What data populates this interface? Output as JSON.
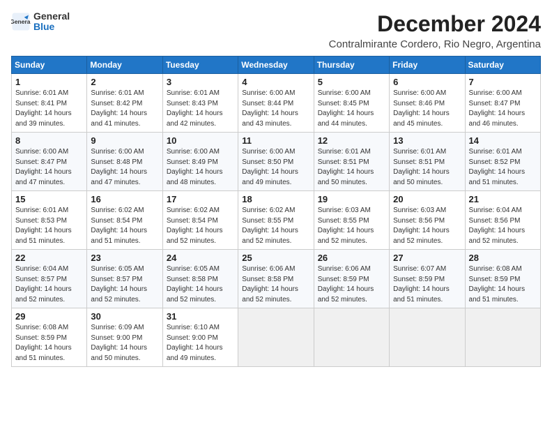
{
  "logo": {
    "general": "General",
    "blue": "Blue"
  },
  "title": "December 2024",
  "subtitle": "Contralmirante Cordero, Rio Negro, Argentina",
  "days_of_week": [
    "Sunday",
    "Monday",
    "Tuesday",
    "Wednesday",
    "Thursday",
    "Friday",
    "Saturday"
  ],
  "weeks": [
    [
      {
        "day": "1",
        "sunrise": "Sunrise: 6:01 AM",
        "sunset": "Sunset: 8:41 PM",
        "daylight": "Daylight: 14 hours and 39 minutes."
      },
      {
        "day": "2",
        "sunrise": "Sunrise: 6:01 AM",
        "sunset": "Sunset: 8:42 PM",
        "daylight": "Daylight: 14 hours and 41 minutes."
      },
      {
        "day": "3",
        "sunrise": "Sunrise: 6:01 AM",
        "sunset": "Sunset: 8:43 PM",
        "daylight": "Daylight: 14 hours and 42 minutes."
      },
      {
        "day": "4",
        "sunrise": "Sunrise: 6:00 AM",
        "sunset": "Sunset: 8:44 PM",
        "daylight": "Daylight: 14 hours and 43 minutes."
      },
      {
        "day": "5",
        "sunrise": "Sunrise: 6:00 AM",
        "sunset": "Sunset: 8:45 PM",
        "daylight": "Daylight: 14 hours and 44 minutes."
      },
      {
        "day": "6",
        "sunrise": "Sunrise: 6:00 AM",
        "sunset": "Sunset: 8:46 PM",
        "daylight": "Daylight: 14 hours and 45 minutes."
      },
      {
        "day": "7",
        "sunrise": "Sunrise: 6:00 AM",
        "sunset": "Sunset: 8:47 PM",
        "daylight": "Daylight: 14 hours and 46 minutes."
      }
    ],
    [
      {
        "day": "8",
        "sunrise": "Sunrise: 6:00 AM",
        "sunset": "Sunset: 8:47 PM",
        "daylight": "Daylight: 14 hours and 47 minutes."
      },
      {
        "day": "9",
        "sunrise": "Sunrise: 6:00 AM",
        "sunset": "Sunset: 8:48 PM",
        "daylight": "Daylight: 14 hours and 47 minutes."
      },
      {
        "day": "10",
        "sunrise": "Sunrise: 6:00 AM",
        "sunset": "Sunset: 8:49 PM",
        "daylight": "Daylight: 14 hours and 48 minutes."
      },
      {
        "day": "11",
        "sunrise": "Sunrise: 6:00 AM",
        "sunset": "Sunset: 8:50 PM",
        "daylight": "Daylight: 14 hours and 49 minutes."
      },
      {
        "day": "12",
        "sunrise": "Sunrise: 6:01 AM",
        "sunset": "Sunset: 8:51 PM",
        "daylight": "Daylight: 14 hours and 50 minutes."
      },
      {
        "day": "13",
        "sunrise": "Sunrise: 6:01 AM",
        "sunset": "Sunset: 8:51 PM",
        "daylight": "Daylight: 14 hours and 50 minutes."
      },
      {
        "day": "14",
        "sunrise": "Sunrise: 6:01 AM",
        "sunset": "Sunset: 8:52 PM",
        "daylight": "Daylight: 14 hours and 51 minutes."
      }
    ],
    [
      {
        "day": "15",
        "sunrise": "Sunrise: 6:01 AM",
        "sunset": "Sunset: 8:53 PM",
        "daylight": "Daylight: 14 hours and 51 minutes."
      },
      {
        "day": "16",
        "sunrise": "Sunrise: 6:02 AM",
        "sunset": "Sunset: 8:54 PM",
        "daylight": "Daylight: 14 hours and 51 minutes."
      },
      {
        "day": "17",
        "sunrise": "Sunrise: 6:02 AM",
        "sunset": "Sunset: 8:54 PM",
        "daylight": "Daylight: 14 hours and 52 minutes."
      },
      {
        "day": "18",
        "sunrise": "Sunrise: 6:02 AM",
        "sunset": "Sunset: 8:55 PM",
        "daylight": "Daylight: 14 hours and 52 minutes."
      },
      {
        "day": "19",
        "sunrise": "Sunrise: 6:03 AM",
        "sunset": "Sunset: 8:55 PM",
        "daylight": "Daylight: 14 hours and 52 minutes."
      },
      {
        "day": "20",
        "sunrise": "Sunrise: 6:03 AM",
        "sunset": "Sunset: 8:56 PM",
        "daylight": "Daylight: 14 hours and 52 minutes."
      },
      {
        "day": "21",
        "sunrise": "Sunrise: 6:04 AM",
        "sunset": "Sunset: 8:56 PM",
        "daylight": "Daylight: 14 hours and 52 minutes."
      }
    ],
    [
      {
        "day": "22",
        "sunrise": "Sunrise: 6:04 AM",
        "sunset": "Sunset: 8:57 PM",
        "daylight": "Daylight: 14 hours and 52 minutes."
      },
      {
        "day": "23",
        "sunrise": "Sunrise: 6:05 AM",
        "sunset": "Sunset: 8:57 PM",
        "daylight": "Daylight: 14 hours and 52 minutes."
      },
      {
        "day": "24",
        "sunrise": "Sunrise: 6:05 AM",
        "sunset": "Sunset: 8:58 PM",
        "daylight": "Daylight: 14 hours and 52 minutes."
      },
      {
        "day": "25",
        "sunrise": "Sunrise: 6:06 AM",
        "sunset": "Sunset: 8:58 PM",
        "daylight": "Daylight: 14 hours and 52 minutes."
      },
      {
        "day": "26",
        "sunrise": "Sunrise: 6:06 AM",
        "sunset": "Sunset: 8:59 PM",
        "daylight": "Daylight: 14 hours and 52 minutes."
      },
      {
        "day": "27",
        "sunrise": "Sunrise: 6:07 AM",
        "sunset": "Sunset: 8:59 PM",
        "daylight": "Daylight: 14 hours and 51 minutes."
      },
      {
        "day": "28",
        "sunrise": "Sunrise: 6:08 AM",
        "sunset": "Sunset: 8:59 PM",
        "daylight": "Daylight: 14 hours and 51 minutes."
      }
    ],
    [
      {
        "day": "29",
        "sunrise": "Sunrise: 6:08 AM",
        "sunset": "Sunset: 8:59 PM",
        "daylight": "Daylight: 14 hours and 51 minutes."
      },
      {
        "day": "30",
        "sunrise": "Sunrise: 6:09 AM",
        "sunset": "Sunset: 9:00 PM",
        "daylight": "Daylight: 14 hours and 50 minutes."
      },
      {
        "day": "31",
        "sunrise": "Sunrise: 6:10 AM",
        "sunset": "Sunset: 9:00 PM",
        "daylight": "Daylight: 14 hours and 49 minutes."
      },
      null,
      null,
      null,
      null
    ]
  ]
}
